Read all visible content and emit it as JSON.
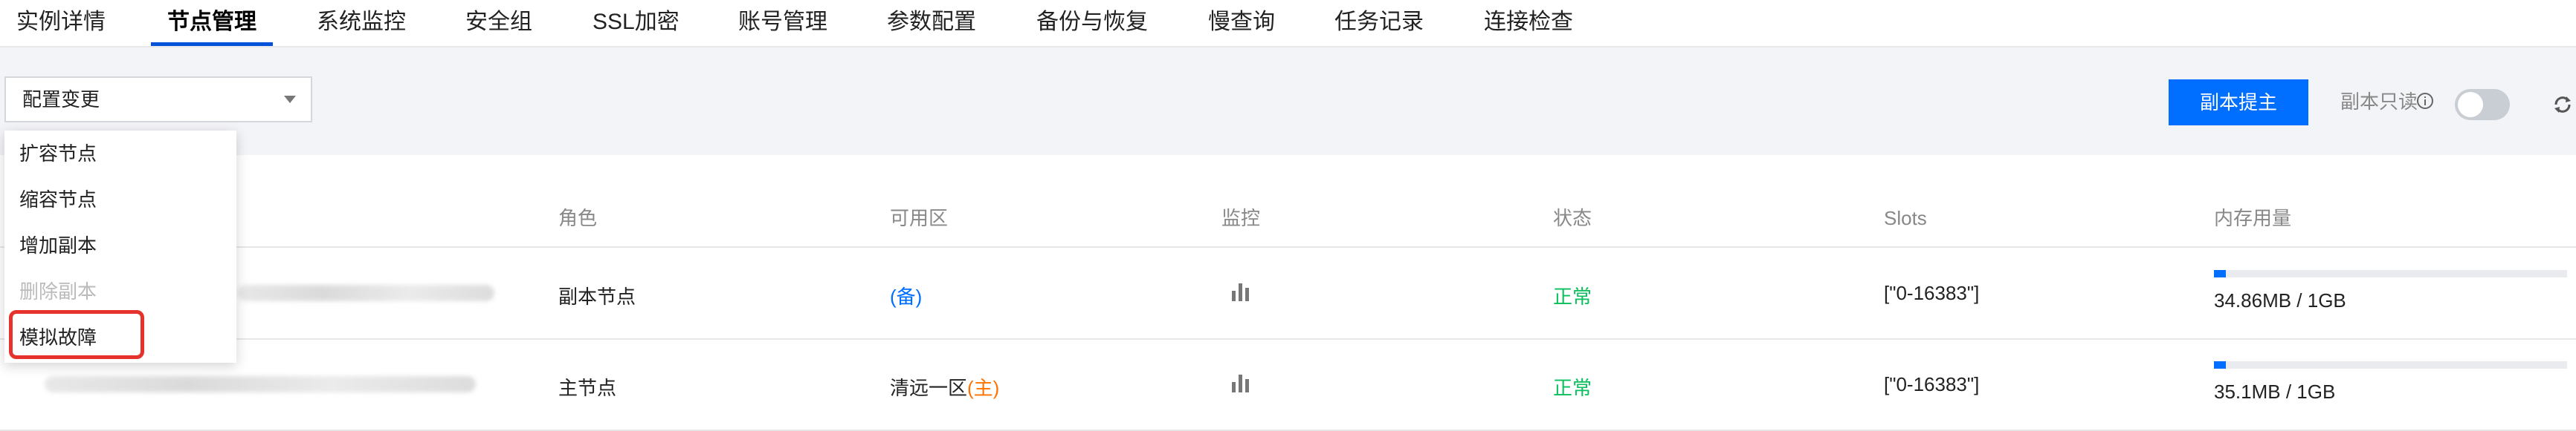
{
  "tabs": [
    {
      "label": "实例详情"
    },
    {
      "label": "节点管理",
      "active": true
    },
    {
      "label": "系统监控"
    },
    {
      "label": "安全组"
    },
    {
      "label": "SSL加密"
    },
    {
      "label": "账号管理"
    },
    {
      "label": "参数配置"
    },
    {
      "label": "备份与恢复"
    },
    {
      "label": "慢查询"
    },
    {
      "label": "任务记录"
    },
    {
      "label": "连接检查"
    }
  ],
  "toolbar": {
    "select_value": "配置变更",
    "promote_button": "副本提主",
    "readonly_label": "副本只读",
    "readonly_enabled": false
  },
  "menu": {
    "items": [
      {
        "label": "扩容节点",
        "disabled": false
      },
      {
        "label": "缩容节点",
        "disabled": false
      },
      {
        "label": "增加副本",
        "disabled": false
      },
      {
        "label": "删除副本",
        "disabled": true
      },
      {
        "label": "模拟故障",
        "disabled": false,
        "highlighted": true
      }
    ]
  },
  "table": {
    "headers": {
      "role": "角色",
      "zone": "可用区",
      "monitor": "监控",
      "status": "状态",
      "slots": "Slots",
      "memory": "内存用量"
    },
    "rows": [
      {
        "role": "副本节点",
        "zone_name": "",
        "zone_tag": "(备)",
        "status": "正常",
        "slots": "[\"0-16383\"]",
        "memory": "34.86MB / 1GB",
        "memory_fraction": 0.034
      },
      {
        "role": "主节点",
        "zone_name": "清远一区",
        "zone_tag": "(主)",
        "status": "正常",
        "slots": "[\"0-16383\"]",
        "memory": "35.1MB / 1GB",
        "memory_fraction": 0.034
      }
    ]
  },
  "colors": {
    "primary": "#006eff",
    "ok": "#0abf5b",
    "master_tag": "#ff7200",
    "highlight_box": "#e5322d"
  }
}
